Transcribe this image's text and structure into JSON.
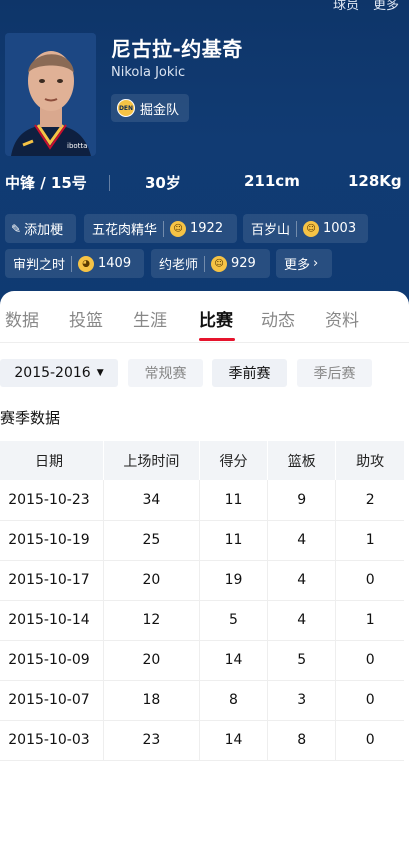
{
  "top_links": [
    "球员",
    "更多"
  ],
  "player": {
    "name": "尼古拉-约基奇",
    "en_name": "Nikola Jokic",
    "team": "掘金队",
    "team_logo_text": "DEN",
    "position_number": "中锋 / 15号",
    "age": "30岁",
    "height": "211cm",
    "weight": "128Kg"
  },
  "tags": {
    "add_label": "添加梗",
    "items": [
      {
        "label": "五花肉精华",
        "count": "1922"
      },
      {
        "label": "百岁山",
        "count": "1003"
      },
      {
        "label": "审判之时",
        "count": "1409"
      },
      {
        "label": "约老师",
        "count": "929"
      }
    ],
    "more_label": "更多"
  },
  "tabs": [
    "数据",
    "投篮",
    "生涯",
    "比赛",
    "动态",
    "资料"
  ],
  "active_tab": "比赛",
  "season": "2015-2016",
  "filters": [
    "常规赛",
    "季前赛",
    "季后赛"
  ],
  "active_filter": "季前赛",
  "section_title": "赛季数据",
  "table": {
    "headers": [
      "日期",
      "上场时间",
      "得分",
      "篮板",
      "助攻"
    ],
    "rows": [
      [
        "2015-10-23",
        "34",
        "11",
        "9",
        "2"
      ],
      [
        "2015-10-19",
        "25",
        "11",
        "4",
        "1"
      ],
      [
        "2015-10-17",
        "20",
        "19",
        "4",
        "0"
      ],
      [
        "2015-10-14",
        "12",
        "5",
        "4",
        "1"
      ],
      [
        "2015-10-09",
        "20",
        "14",
        "5",
        "0"
      ],
      [
        "2015-10-07",
        "18",
        "8",
        "3",
        "0"
      ],
      [
        "2015-10-03",
        "23",
        "14",
        "8",
        "0"
      ]
    ]
  },
  "colors": {
    "hero_bg": "#0f3a72",
    "accent": "#e6142d",
    "tag_bg": "#1d4a82"
  }
}
